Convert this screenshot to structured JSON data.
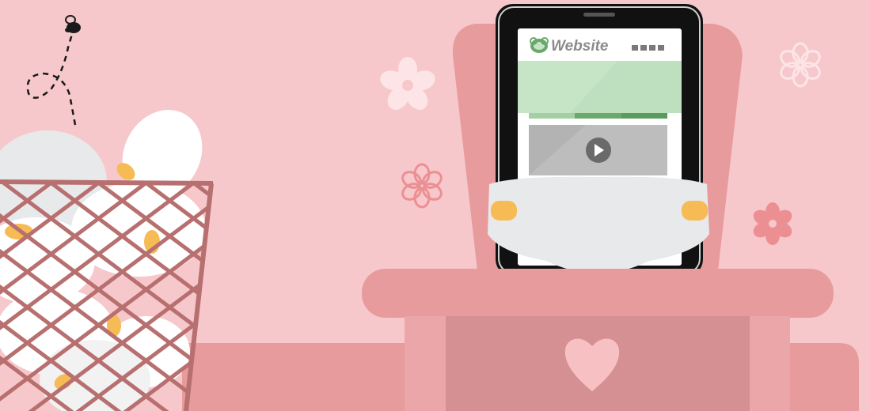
{
  "scene": {
    "description_tags": [
      "illustration",
      "baby-nursery",
      "tablet-in-diaper",
      "changing-table",
      "diaper-waste-basket"
    ],
    "colors": {
      "background": "#f7c8cb",
      "furniture_main": "#e89b9d",
      "furniture_panel": "#d49092",
      "heart": "#f7c0c3",
      "diaper": "#e8e9ea",
      "diaper_tab": "#f6bb54",
      "basket_wire": "#b7706f",
      "website_banner": "#c6e5c6",
      "website_accent": "#6aa86c",
      "video_block": "#b3b3b3",
      "flower_light": "#fde4e6",
      "flower_dark": "#ec8f93"
    }
  },
  "tablet": {
    "website_title": "Website",
    "logo_icon": "pacifier-icon",
    "play_icon": "play-icon",
    "menu_icon": "hamburger-dots-icon"
  }
}
